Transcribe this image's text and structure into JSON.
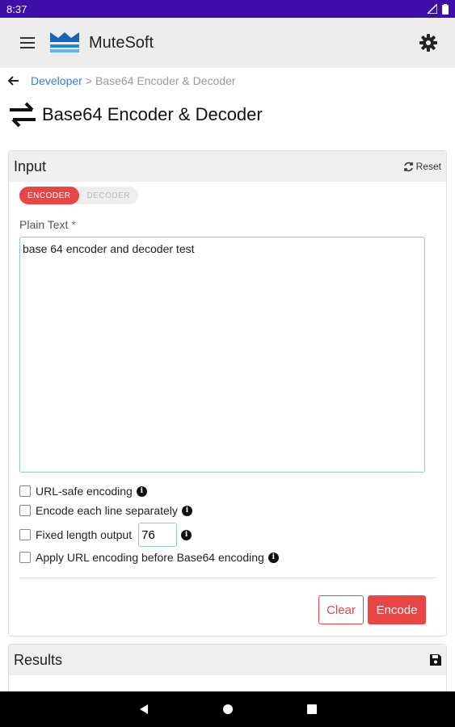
{
  "status": {
    "time": "8:37"
  },
  "app": {
    "name": "MuteSoft"
  },
  "breadcrumb": {
    "parent": "Developer",
    "separator": ">",
    "current": "Base64 Encoder & Decoder"
  },
  "page": {
    "title": "Base64 Encoder & Decoder"
  },
  "input_card": {
    "title": "Input",
    "reset_label": "Reset",
    "modes": [
      "ENCODER",
      "DECODER"
    ],
    "active_mode": "ENCODER",
    "field_label": "Plain Text",
    "required_mark": "*",
    "text_value": "base 64 encoder and decoder test",
    "options": [
      {
        "label": "URL-safe encoding",
        "checked": false
      },
      {
        "label": "Encode each line separately",
        "checked": false
      },
      {
        "label": "Fixed length output",
        "checked": false,
        "value": "76"
      },
      {
        "label": "Apply URL encoding before Base64 encoding",
        "checked": false
      }
    ],
    "clear_label": "Clear",
    "encode_label": "Encode"
  },
  "results_card": {
    "title": "Results"
  },
  "colors": {
    "accent": "#e94545",
    "status_bar": "#3d0ea8",
    "link": "#3a7bd5",
    "focus_border": "#8ec1ee"
  },
  "icons": [
    "menu-icon",
    "mutesoft-logo",
    "gear-icon",
    "back-arrow-icon",
    "swap-arrows-icon",
    "refresh-icon",
    "info-icon",
    "save-icon",
    "nav-back-icon",
    "nav-home-icon",
    "nav-recents-icon"
  ]
}
